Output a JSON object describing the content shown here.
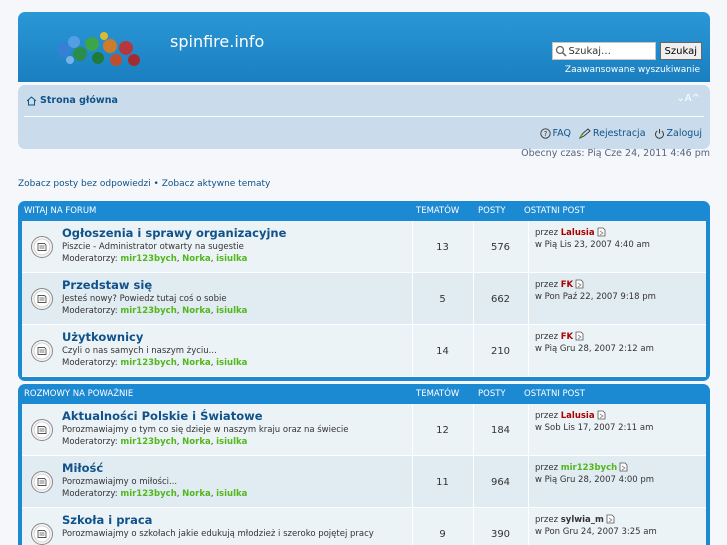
{
  "site": {
    "title": "spinfire.info"
  },
  "search": {
    "placeholder": "Szukaj…",
    "button": "Szukaj",
    "advanced": "Zaawansowane wyszukiwanie"
  },
  "nav": {
    "home": "Strona główna",
    "font_size": "⌄A^",
    "faq": "FAQ",
    "register": "Rejestracja",
    "login": "Zaloguj"
  },
  "current_time": "Obecny czas: Pią Cze 24, 2011 4:46 pm",
  "quick_links": {
    "unanswered": "Zobacz posty bez odpowiedzi",
    "sep": " • ",
    "active": "Zobacz aktywne tematy"
  },
  "headers": {
    "topics": "TEMATÓW",
    "posts": "POSTY",
    "last_post": "OSTATNI POST"
  },
  "categories": [
    {
      "title": "WITAJ NA FORUM",
      "forums": [
        {
          "name": "Ogłoszenia i sprawy organizacyjne",
          "desc": "Piszcie - Administrator otwarty na sugestie",
          "mods_label": "Moderatorzy: ",
          "mods": [
            "mir123bych",
            "Norka",
            "isiulka"
          ],
          "topics": "13",
          "posts": "576",
          "last_by": "przez ",
          "last_author": "Lalusia",
          "last_author_color": "#aa0000",
          "last_date": "w Pią Lis 23, 2007 4:40 am"
        },
        {
          "name": "Przedstaw się",
          "desc": "Jesteś nowy? Powiedz tutaj coś o sobie",
          "mods_label": "Moderatorzy: ",
          "mods": [
            "mir123bych",
            "Norka",
            "isiulka"
          ],
          "topics": "5",
          "posts": "662",
          "last_by": "przez ",
          "last_author": "FK",
          "last_author_color": "#aa0000",
          "last_date": "w Pon Paź 22, 2007 9:18 pm"
        },
        {
          "name": "Użytkownicy",
          "desc": "Czyli o nas samych i naszym życiu...",
          "mods_label": "Moderatorzy: ",
          "mods": [
            "mir123bych",
            "Norka",
            "isiulka"
          ],
          "topics": "14",
          "posts": "210",
          "last_by": "przez ",
          "last_author": "FK",
          "last_author_color": "#aa0000",
          "last_date": "w Pią Gru 28, 2007 2:12 am"
        }
      ]
    },
    {
      "title": "ROZMOWY NA POWAŻNIE",
      "forums": [
        {
          "name": "Aktualności Polskie i Światowe",
          "desc": "Porozmawiajmy o tym co się dzieje w naszym kraju oraz na świecie",
          "mods_label": "Moderatorzy: ",
          "mods": [
            "mir123bych",
            "Norka",
            "isiulka"
          ],
          "topics": "12",
          "posts": "184",
          "last_by": "przez ",
          "last_author": "Lalusia",
          "last_author_color": "#aa0000",
          "last_date": "w Sob Lis 17, 2007 2:11 am"
        },
        {
          "name": "Miłość",
          "desc": "Porozmawiajmy o miłości...",
          "mods_label": "Moderatorzy: ",
          "mods": [
            "mir123bych",
            "Norka",
            "isiulka"
          ],
          "topics": "11",
          "posts": "964",
          "last_by": "przez ",
          "last_author": "mir123bych",
          "last_author_color": "#52b71b",
          "last_date": "w Pią Gru 28, 2007 4:00 pm"
        },
        {
          "name": "Szkoła i praca",
          "desc": "Porozmawiajmy o szkołach jakie edukują młodzież i szeroko pojętej pracy",
          "mods_label": "",
          "mods": [],
          "topics": "9",
          "posts": "390",
          "last_by": "przez ",
          "last_author": "sylwia_m",
          "last_author_color": "#333333",
          "last_date": "w Pon Gru 24, 2007 3:25 am"
        }
      ]
    }
  ],
  "colors": {
    "header_blue": "#1c89d3",
    "link": "#105289",
    "moderator": "#52b71b",
    "admin": "#aa0000"
  }
}
